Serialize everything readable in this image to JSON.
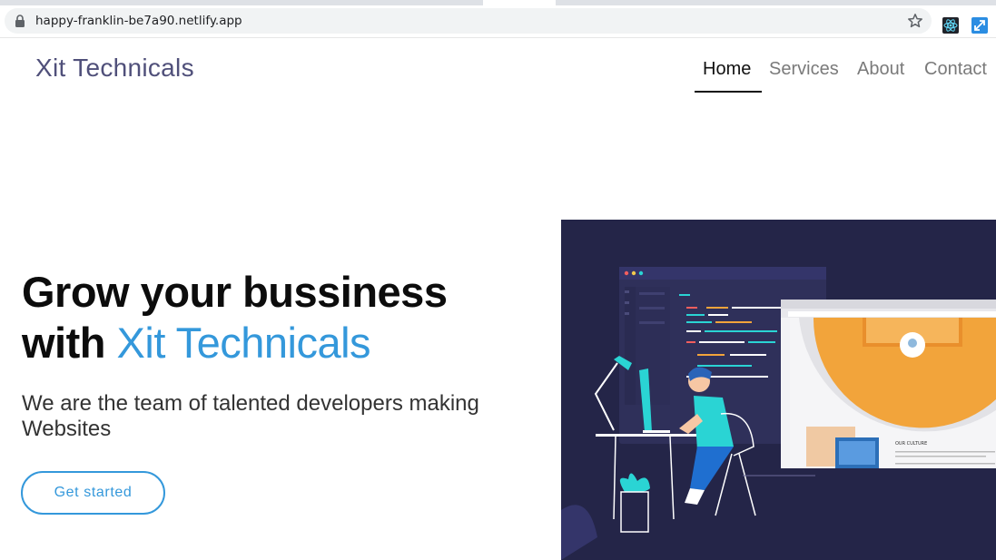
{
  "browser": {
    "url": "happy-franklin-be7a90.netlify.app",
    "icons": [
      "lock-icon",
      "star-icon",
      "react-devtools-icon",
      "resize-extension-icon"
    ]
  },
  "site": {
    "logo": "Xit Technicals",
    "nav": [
      {
        "label": "Home",
        "active": true
      },
      {
        "label": "Services",
        "active": false
      },
      {
        "label": "About",
        "active": false
      },
      {
        "label": "Contact",
        "active": false
      }
    ]
  },
  "hero": {
    "title_line1": "Grow your bussiness",
    "title_line2_prefix": "with",
    "title_brand": "Xit Technicals",
    "subtitle": "We are the team of talented developers making Websites",
    "cta": "Get started",
    "illustration": {
      "card_heading": "OUR CULTURE"
    }
  },
  "colors": {
    "brand_blue": "#3498db",
    "logo": "#50507a",
    "illustration_bg": "#242548",
    "accent_orange": "#f2a43b",
    "accent_teal": "#2ad4d4"
  }
}
